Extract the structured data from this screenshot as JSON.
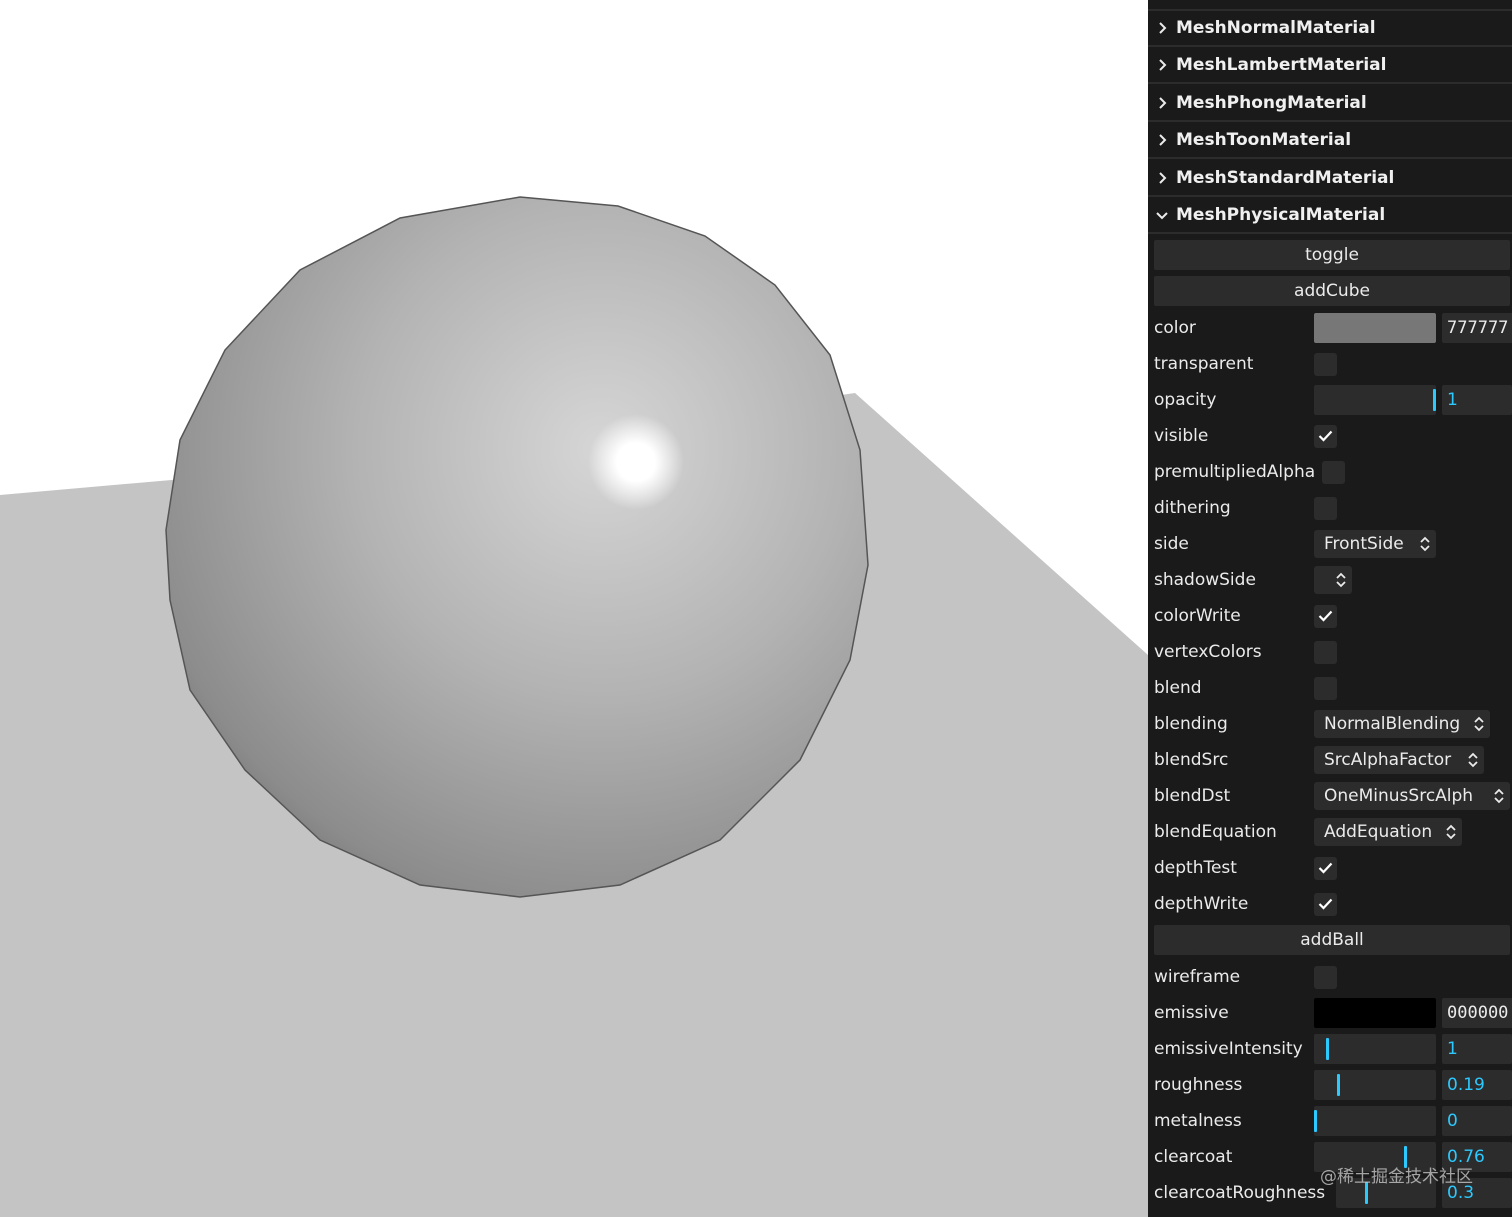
{
  "scene": {
    "background": "#ffffff",
    "plane_color": "#c4c4c4",
    "sphere_color": "#777777"
  },
  "panel": {
    "folders": [
      {
        "label": "MeshNormalMaterial",
        "expanded": false
      },
      {
        "label": "MeshLambertMaterial",
        "expanded": false
      },
      {
        "label": "MeshPhongMaterial",
        "expanded": false
      },
      {
        "label": "MeshToonMaterial",
        "expanded": false
      },
      {
        "label": "MeshStandardMaterial",
        "expanded": false
      },
      {
        "label": "MeshPhysicalMaterial",
        "expanded": true
      }
    ],
    "buttons": {
      "toggle": "toggle",
      "add_cube": "addCube",
      "add_ball": "addBall"
    },
    "controls": {
      "color": {
        "label": "color",
        "value": "777777",
        "swatch": "#777777"
      },
      "transparent": {
        "label": "transparent",
        "checked": false
      },
      "opacity": {
        "label": "opacity",
        "value": "1",
        "fraction": 1
      },
      "visible": {
        "label": "visible",
        "checked": true
      },
      "premultipliedAlpha": {
        "label": "premultipliedAlpha",
        "checked": false
      },
      "dithering": {
        "label": "dithering",
        "checked": false
      },
      "side": {
        "label": "side",
        "value": "FrontSide"
      },
      "shadowSide": {
        "label": "shadowSide",
        "value": ""
      },
      "colorWrite": {
        "label": "colorWrite",
        "checked": true
      },
      "vertexColors": {
        "label": "vertexColors",
        "checked": false
      },
      "blend": {
        "label": "blend",
        "checked": false
      },
      "blending": {
        "label": "blending",
        "value": "NormalBlending"
      },
      "blendSrc": {
        "label": "blendSrc",
        "value": "SrcAlphaFactor"
      },
      "blendDst": {
        "label": "blendDst",
        "value": "OneMinusSrcAlph"
      },
      "blendEquation": {
        "label": "blendEquation",
        "value": "AddEquation"
      },
      "depthTest": {
        "label": "depthTest",
        "checked": true
      },
      "depthWrite": {
        "label": "depthWrite",
        "checked": true
      },
      "wireframe": {
        "label": "wireframe",
        "checked": false
      },
      "emissive": {
        "label": "emissive",
        "value": "000000",
        "swatch": "#000000"
      },
      "emissiveIntensity": {
        "label": "emissiveIntensity",
        "value": "1",
        "fraction": 0.1
      },
      "roughness": {
        "label": "roughness",
        "value": "0.19",
        "fraction": 0.19
      },
      "metalness": {
        "label": "metalness",
        "value": "0",
        "fraction": 0
      },
      "clearcoat": {
        "label": "clearcoat",
        "value": "0.76",
        "fraction": 0.76
      },
      "clearcoatRoughness": {
        "label": "clearcoatRoughness",
        "value": "0.3",
        "fraction": 0.3
      }
    }
  },
  "watermark": "@稀土掘金技术社区"
}
